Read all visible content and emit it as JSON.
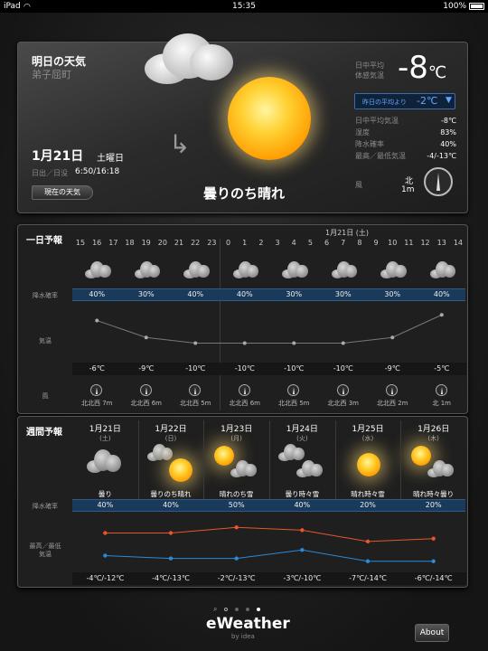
{
  "status": {
    "device": "iPad",
    "time": "15:35",
    "battery": "100%"
  },
  "today": {
    "title": "明日の天気",
    "location": "弟子屈町",
    "date": "1月21日",
    "weekday": "土曜日",
    "sun_label": "日出／日没",
    "sun_times": "6:50/16:18",
    "back_button": "現在の天気",
    "condition": "曇りのち晴れ",
    "feel_label1": "日中平均",
    "feel_label2": "体感気温",
    "feel_temp": "-8",
    "feel_unit": "℃",
    "diff_label": "昨日の平均より",
    "diff_value": "-2℃",
    "diff_arrow": "▼",
    "stats": [
      {
        "label": "日中平均気温",
        "value": "-8℃"
      },
      {
        "label": "湿度",
        "value": "83%"
      },
      {
        "label": "降水確率",
        "value": "40%"
      },
      {
        "label": "最高／最低気温",
        "value": "-4/-13℃"
      }
    ],
    "wind_label": "風",
    "wind_dir": "北",
    "wind_speed": "1m"
  },
  "hourly": {
    "title": "一日予報",
    "date_label": "1月21日 (土)",
    "hours": [
      "15",
      "16",
      "17",
      "18",
      "19",
      "20",
      "21",
      "22",
      "23",
      "0",
      "1",
      "2",
      "3",
      "4",
      "5",
      "6",
      "7",
      "8",
      "9",
      "10",
      "11",
      "12",
      "13",
      "14"
    ],
    "rain_label": "降水確率",
    "temp_label": "気温",
    "wind_label": "風",
    "chart_data": {
      "type": "line",
      "x": [
        "15",
        "18",
        "21",
        "0",
        "3",
        "6",
        "9",
        "12"
      ],
      "values": [
        -6,
        -9,
        -10,
        -10,
        -10,
        -10,
        -9,
        -5
      ],
      "ylim": [
        -12,
        -4
      ]
    },
    "slots": [
      {
        "rain": "40%",
        "temp": "-6℃",
        "wind": "北北西 7m"
      },
      {
        "rain": "30%",
        "temp": "-9℃",
        "wind": "北北西 6m"
      },
      {
        "rain": "40%",
        "temp": "-10℃",
        "wind": "北北西 5m"
      },
      {
        "rain": "40%",
        "temp": "-10℃",
        "wind": "北北西 6m"
      },
      {
        "rain": "30%",
        "temp": "-10℃",
        "wind": "北北西 5m"
      },
      {
        "rain": "30%",
        "temp": "-10℃",
        "wind": "北北西 3m"
      },
      {
        "rain": "30%",
        "temp": "-9℃",
        "wind": "北北西 2m"
      },
      {
        "rain": "40%",
        "temp": "-5℃",
        "wind": "北 1m"
      }
    ]
  },
  "weekly": {
    "title": "週間予報",
    "rain_label": "降水確率",
    "temp_label1": "最高／最低",
    "temp_label2": "気温",
    "days": [
      {
        "date": "1月21日",
        "dow": "(土)",
        "cond": "曇り",
        "rain": "40%",
        "temp": "-4℃/-12℃"
      },
      {
        "date": "1月22日",
        "dow": "(日)",
        "cond": "曇りのち晴れ",
        "rain": "40%",
        "temp": "-4℃/-13℃"
      },
      {
        "date": "1月23日",
        "dow": "(月)",
        "cond": "晴れのち雪",
        "rain": "50%",
        "temp": "-2℃/-13℃"
      },
      {
        "date": "1月24日",
        "dow": "(火)",
        "cond": "曇り時々雪",
        "rain": "40%",
        "temp": "-3℃/-10℃"
      },
      {
        "date": "1月25日",
        "dow": "(水)",
        "cond": "晴れ時々雪",
        "rain": "20%",
        "temp": "-7℃/-14℃"
      },
      {
        "date": "1月26日",
        "dow": "(木)",
        "cond": "晴れ時々曇り",
        "rain": "20%",
        "temp": "-6℃/-14℃"
      }
    ],
    "chart_data": {
      "type": "line",
      "categories": [
        "1月21日",
        "1月22日",
        "1月23日",
        "1月24日",
        "1月25日",
        "1月26日"
      ],
      "series": [
        {
          "values": [
            -4,
            -4,
            -2,
            -3,
            -7,
            -6
          ],
          "color": "#e8552a"
        },
        {
          "values": [
            -12,
            -13,
            -13,
            -10,
            -14,
            -14
          ],
          "color": "#2a8ad8"
        }
      ],
      "ylim": [
        -16,
        0
      ]
    }
  },
  "footer": {
    "brand": "eWeather",
    "byline": "by idea",
    "about": "About",
    "page_indicator": {
      "current": 5,
      "total": 5
    }
  }
}
